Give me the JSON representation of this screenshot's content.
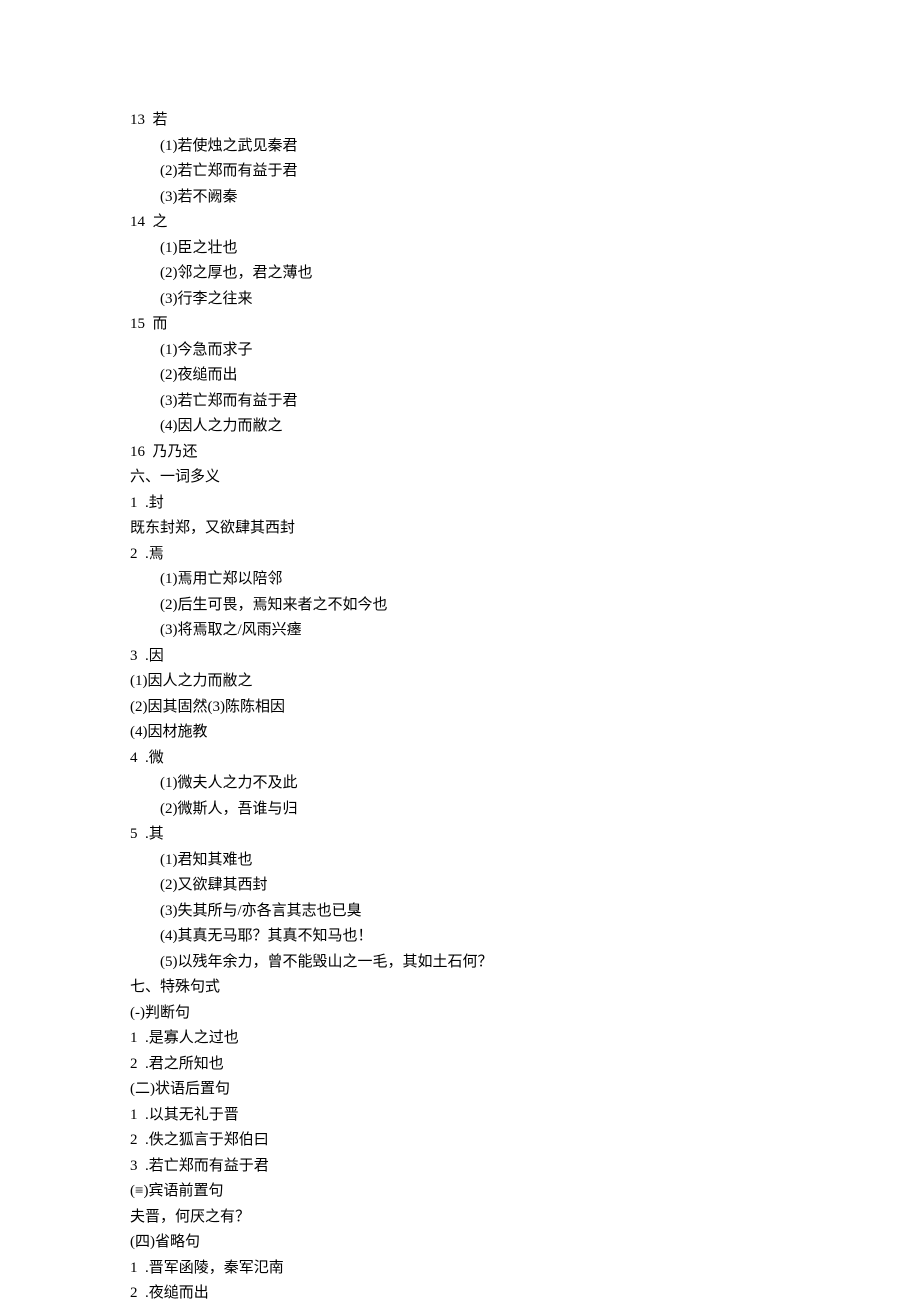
{
  "lines": [
    {
      "text": "13  若",
      "indent": false
    },
    {
      "text": "(1)若使烛之武见秦君",
      "indent": true
    },
    {
      "text": "(2)若亡郑而有益于君",
      "indent": true
    },
    {
      "text": "(3)若不阙秦",
      "indent": true
    },
    {
      "text": "14  之",
      "indent": false
    },
    {
      "text": "(1)臣之壮也",
      "indent": true
    },
    {
      "text": "(2)邻之厚也，君之薄也",
      "indent": true
    },
    {
      "text": "(3)行李之往来",
      "indent": true
    },
    {
      "text": "15  而",
      "indent": false
    },
    {
      "text": "(1)今急而求子",
      "indent": true
    },
    {
      "text": "(2)夜缒而出",
      "indent": true
    },
    {
      "text": "(3)若亡郑而有益于君",
      "indent": true
    },
    {
      "text": "(4)因人之力而敝之",
      "indent": true
    },
    {
      "text": "16  乃乃还",
      "indent": false
    },
    {
      "text": "六、一词多义",
      "indent": false
    },
    {
      "text": "1  .封",
      "indent": false
    },
    {
      "text": "既东封郑，又欲肆其西封",
      "indent": false
    },
    {
      "text": "2  .焉",
      "indent": false
    },
    {
      "text": "(1)焉用亡郑以陪邻",
      "indent": true
    },
    {
      "text": "(2)后生可畏，焉知来者之不如今也",
      "indent": true
    },
    {
      "text": "(3)将焉取之/风雨兴瘗",
      "indent": true
    },
    {
      "text": "3  .因",
      "indent": false
    },
    {
      "text": "(1)因人之力而敝之",
      "indent": false
    },
    {
      "text": "(2)因其固然(3)陈陈相因",
      "indent": false
    },
    {
      "text": "(4)因材施教",
      "indent": false
    },
    {
      "text": "4  .微",
      "indent": false
    },
    {
      "text": "(1)微夫人之力不及此",
      "indent": true
    },
    {
      "text": "(2)微斯人，吾谁与归",
      "indent": true
    },
    {
      "text": "5  .其",
      "indent": false
    },
    {
      "text": "(1)君知其难也",
      "indent": true
    },
    {
      "text": "(2)又欲肆其西封",
      "indent": true
    },
    {
      "text": "(3)失其所与/亦各言其志也已臭",
      "indent": true
    },
    {
      "text": "(4)其真无马耶？其真不知马也！",
      "indent": true
    },
    {
      "text": "(5)以残年余力，曾不能毁山之一毛，其如土石何？",
      "indent": true
    },
    {
      "text": "七、特殊句式",
      "indent": false
    },
    {
      "text": "(-)判断句",
      "indent": false
    },
    {
      "text": "1  .是寡人之过也",
      "indent": false
    },
    {
      "text": "2  .君之所知也",
      "indent": false
    },
    {
      "text": "(二)状语后置句",
      "indent": false
    },
    {
      "text": "1  .以其无礼于晋",
      "indent": false
    },
    {
      "text": "2  .佚之狐言于郑伯曰",
      "indent": false
    },
    {
      "text": "3  .若亡郑而有益于君",
      "indent": false
    },
    {
      "text": "(≡)宾语前置句",
      "indent": false
    },
    {
      "text": "夫晋，何厌之有？",
      "indent": false
    },
    {
      "text": "(四)省略句",
      "indent": false
    },
    {
      "text": "1  .晋军函陵，秦军氾南",
      "indent": false
    },
    {
      "text": "2  .夜缒而出",
      "indent": false
    }
  ]
}
